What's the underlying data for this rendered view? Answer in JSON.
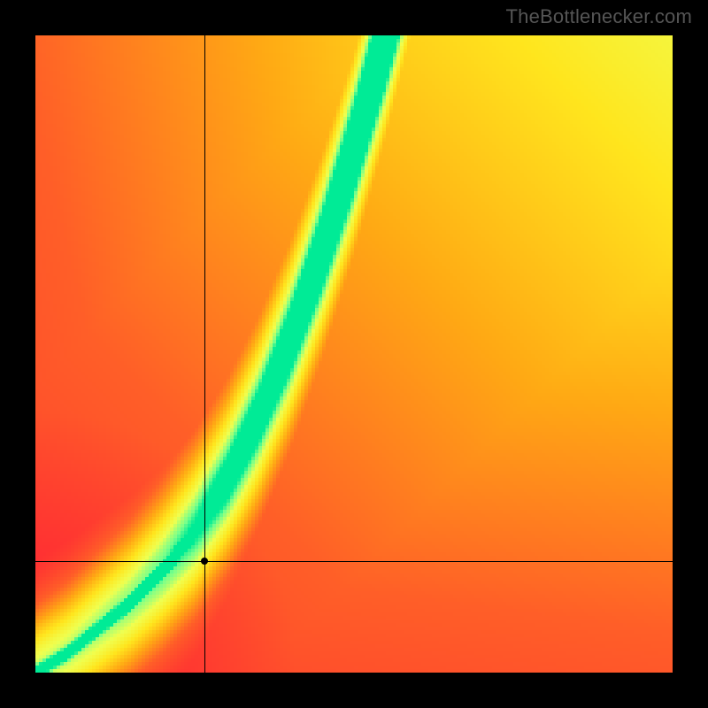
{
  "watermark": "TheBottlenecker.com",
  "chart_data": {
    "type": "heatmap",
    "title": "",
    "xlabel": "",
    "ylabel": "",
    "xlim": [
      0,
      1
    ],
    "ylim": [
      0,
      1
    ],
    "resolution": 180,
    "colormap": {
      "stops": [
        {
          "t": 0.0,
          "rgb": [
            255,
            30,
            55
          ]
        },
        {
          "t": 0.35,
          "rgb": [
            255,
            95,
            40
          ]
        },
        {
          "t": 0.55,
          "rgb": [
            255,
            170,
            20
          ]
        },
        {
          "t": 0.72,
          "rgb": [
            255,
            230,
            30
          ]
        },
        {
          "t": 0.85,
          "rgb": [
            240,
            255,
            80
          ]
        },
        {
          "t": 0.95,
          "rgb": [
            120,
            255,
            140
          ]
        },
        {
          "t": 1.0,
          "rgb": [
            0,
            235,
            150
          ]
        }
      ]
    },
    "ridge": {
      "description": "green optimum curve y(x); values are y for x in [0,1] sampled at 0.05",
      "x": [
        0.0,
        0.05,
        0.1,
        0.15,
        0.2,
        0.25,
        0.3,
        0.35,
        0.4,
        0.45,
        0.5,
        0.55,
        0.6,
        0.65,
        0.7,
        0.75,
        0.8,
        0.85,
        0.9,
        0.95,
        1.0
      ],
      "y": [
        0.0,
        0.03,
        0.07,
        0.11,
        0.16,
        0.22,
        0.3,
        0.4,
        0.52,
        0.66,
        0.82,
        1.0,
        1.2,
        1.42,
        1.66,
        1.92,
        2.2,
        2.5,
        2.82,
        3.16,
        3.52
      ],
      "note": "y>1 is above the visible area; x beyond ~0.55 the ridge exits top"
    },
    "ridge_half_width": 0.025,
    "background_field": "radial warm gradient, hottest toward upper-right, cold toward lower-left and far right-bottom",
    "crosshair": {
      "x": 0.265,
      "y": 0.175
    },
    "marker": {
      "x": 0.265,
      "y": 0.175
    }
  }
}
